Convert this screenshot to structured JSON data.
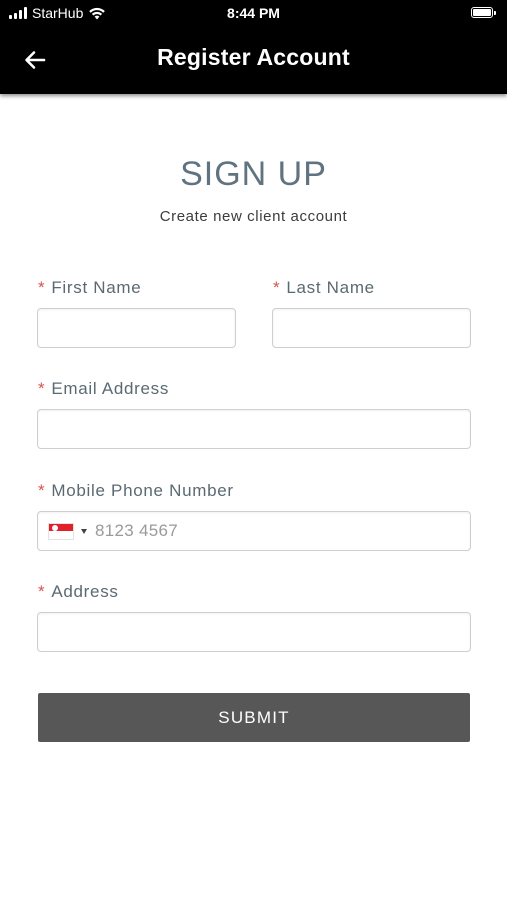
{
  "status_bar": {
    "carrier": "StarHub",
    "time": "8:44 PM"
  },
  "app_bar": {
    "title": "Register Account",
    "back_icon": "arrow-left-icon"
  },
  "form": {
    "heading": "SIGN UP",
    "subheading": "Create new client account",
    "required_marker": "*",
    "fields": {
      "first_name": {
        "label": "First Name",
        "value": ""
      },
      "last_name": {
        "label": "Last Name",
        "value": ""
      },
      "email": {
        "label": "Email Address",
        "value": ""
      },
      "mobile": {
        "label": "Mobile Phone Number",
        "country_flag": "singapore-flag-icon",
        "placeholder": "8123 4567"
      },
      "address": {
        "label": "Address",
        "value": ""
      }
    },
    "submit_label": "SUBMIT"
  },
  "colors": {
    "app_bar_bg": "#000000",
    "heading": "#5f7380",
    "label": "#5b6a72",
    "required": "#d9534f",
    "submit_bg": "#575757"
  }
}
